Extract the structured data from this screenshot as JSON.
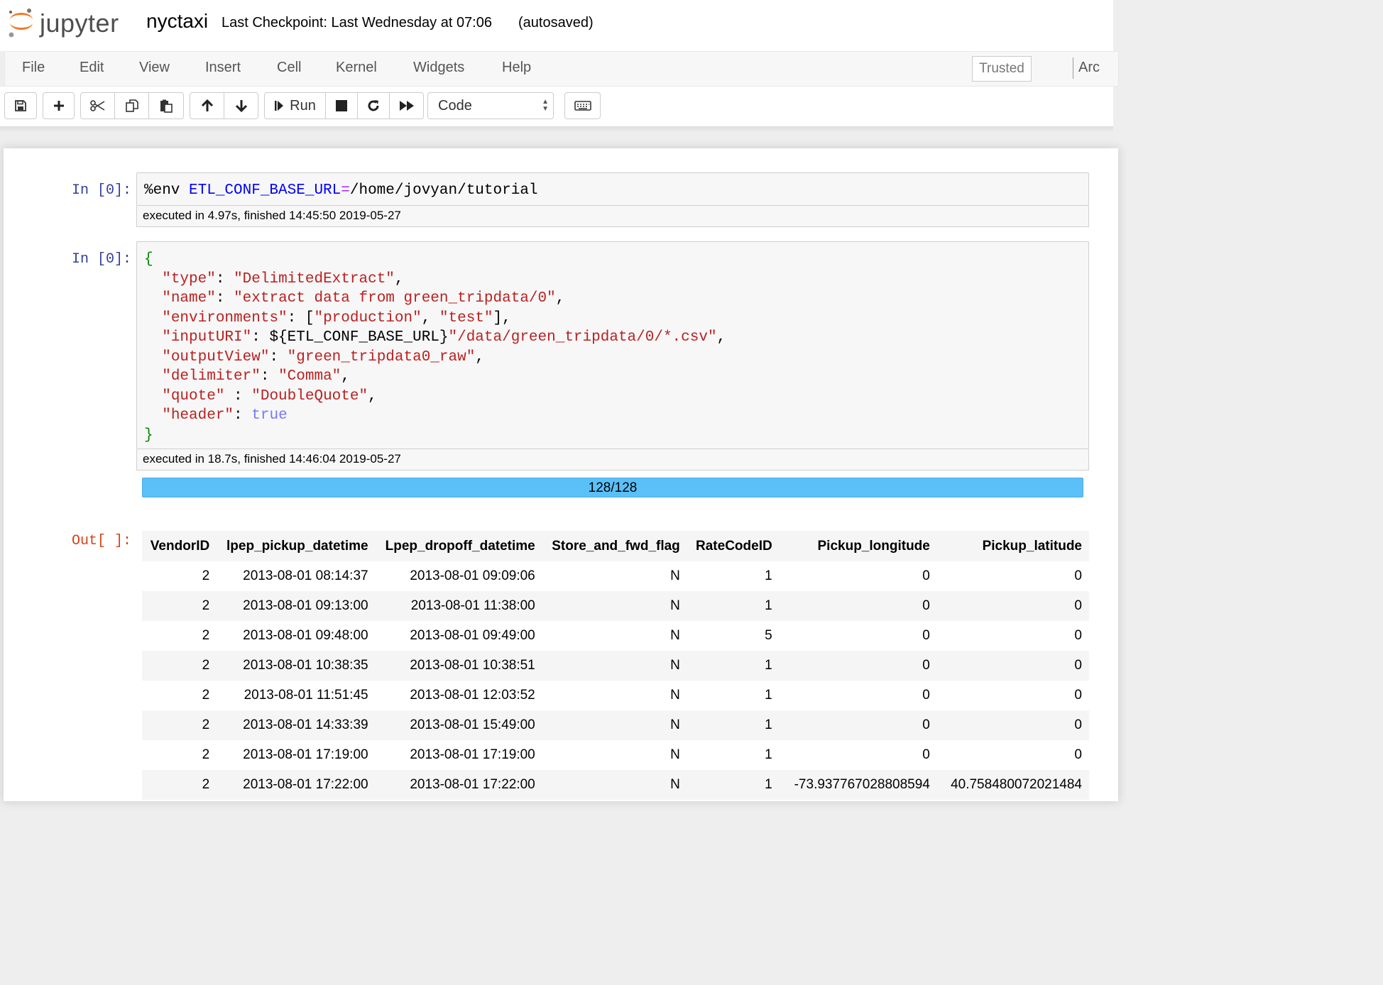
{
  "header": {
    "logo_text": "jupyter",
    "notebook_name": "nyctaxi",
    "checkpoint": "Last Checkpoint: Last Wednesday at 07:06",
    "autosave": "(autosaved)"
  },
  "menubar": {
    "items": [
      "File",
      "Edit",
      "View",
      "Insert",
      "Cell",
      "Kernel",
      "Widgets",
      "Help"
    ],
    "trusted": "Trusted",
    "kernel_name": "Arc"
  },
  "toolbar": {
    "run_label": "Run",
    "cell_type": "Code",
    "buttons": [
      "save-icon",
      "plus-icon",
      "scissors-icon",
      "copy-icon",
      "paste-icon",
      "arrow-up-icon",
      "arrow-down-icon",
      "step-icon",
      "stop-icon",
      "restart-icon",
      "fast-forward-icon",
      "keyboard-icon"
    ]
  },
  "cells": [
    {
      "prompt": "In [0]:",
      "code": {
        "magic": "%env ",
        "var": "ETL_CONF_BASE_URL",
        "eq": "=",
        "value": "/home/jovyan/tutorial"
      },
      "exec_info": "executed in 4.97s, finished 14:45:50 2019-05-27"
    },
    {
      "prompt": "In [0]:",
      "code_lines": [
        {
          "key": "\"type\"",
          "sep": ": ",
          "val": "\"DelimitedExtract\"",
          "end": ","
        },
        {
          "key": "\"name\"",
          "sep": ": ",
          "val": "\"extract data from green_tripdata/0\"",
          "end": ","
        },
        {
          "key": "\"environments\"",
          "sep": ": [",
          "val": "\"production\"",
          "mid": ", ",
          "val2": "\"test\"",
          "end": "],"
        },
        {
          "key": "\"inputURI\"",
          "sep": ": ${ETL_CONF_BASE_URL}",
          "val": "\"/data/green_tripdata/0/*.csv\"",
          "end": ","
        },
        {
          "key": "\"outputView\"",
          "sep": ": ",
          "val": "\"green_tripdata0_raw\"",
          "end": ","
        },
        {
          "key": "\"delimiter\"",
          "sep": ": ",
          "val": "\"Comma\"",
          "end": ","
        },
        {
          "key": "\"quote\"",
          "sep": " : ",
          "val": "\"DoubleQuote\"",
          "end": ","
        },
        {
          "key": "\"header\"",
          "sep": ": ",
          "bool": "true",
          "end": ""
        }
      ],
      "open_brace": "{",
      "close_brace": "}",
      "exec_info": "executed in 18.7s, finished 14:46:04 2019-05-27",
      "progress": {
        "text": "128/128",
        "fraction": 1.0
      }
    },
    {
      "prompt": "Out[ ]:"
    }
  ],
  "table": {
    "columns": [
      "VendorID",
      "lpep_pickup_datetime",
      "Lpep_dropoff_datetime",
      "Store_and_fwd_flag",
      "RateCodeID",
      "Pickup_longitude",
      "Pickup_latitude"
    ],
    "rows": [
      [
        "2",
        "2013-08-01 08:14:37",
        "2013-08-01 09:09:06",
        "N",
        "1",
        "0",
        "0"
      ],
      [
        "2",
        "2013-08-01 09:13:00",
        "2013-08-01 11:38:00",
        "N",
        "1",
        "0",
        "0"
      ],
      [
        "2",
        "2013-08-01 09:48:00",
        "2013-08-01 09:49:00",
        "N",
        "5",
        "0",
        "0"
      ],
      [
        "2",
        "2013-08-01 10:38:35",
        "2013-08-01 10:38:51",
        "N",
        "1",
        "0",
        "0"
      ],
      [
        "2",
        "2013-08-01 11:51:45",
        "2013-08-01 12:03:52",
        "N",
        "1",
        "0",
        "0"
      ],
      [
        "2",
        "2013-08-01 14:33:39",
        "2013-08-01 15:49:00",
        "N",
        "1",
        "0",
        "0"
      ],
      [
        "2",
        "2013-08-01 17:19:00",
        "2013-08-01 17:19:00",
        "N",
        "1",
        "0",
        "0"
      ],
      [
        "2",
        "2013-08-01 17:22:00",
        "2013-08-01 17:22:00",
        "N",
        "1",
        "-73.937767028808594",
        "40.758480072021484"
      ]
    ]
  },
  "colors": {
    "in_prompt": "#303f9f",
    "out_prompt": "#d84315",
    "progress": "#5bc0f8",
    "logo_orange": "#f37726"
  }
}
